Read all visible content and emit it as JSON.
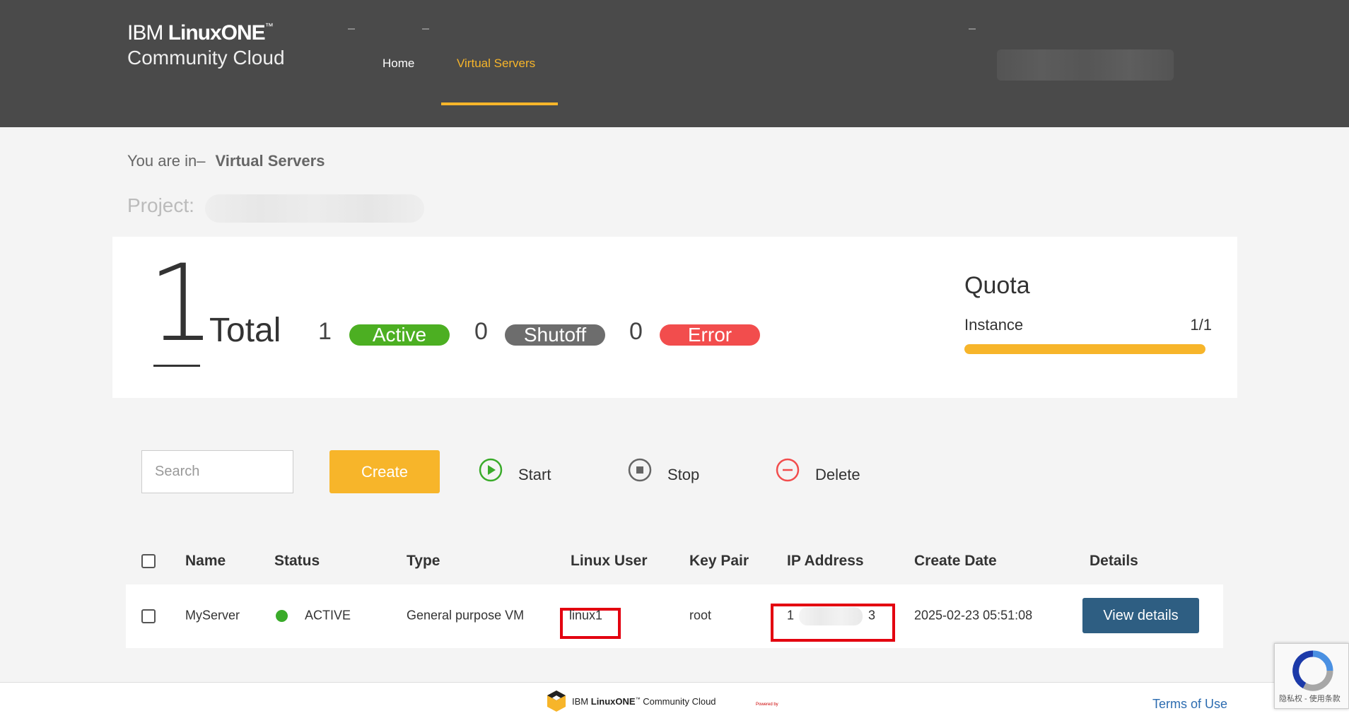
{
  "header": {
    "brand_ibm": "IBM",
    "brand_product": "LinuxONE",
    "brand_tm": "™",
    "brand_line2": "Community Cloud",
    "nav": [
      {
        "label": "Home"
      },
      {
        "label": "Virtual Servers",
        "active": true
      }
    ],
    "accent_color": "#f7b52a"
  },
  "breadcrumb": {
    "prefix": "You are in–",
    "current": "Virtual Servers"
  },
  "project": {
    "label": "Project:"
  },
  "summary": {
    "total_count": "1",
    "total_label": "Total",
    "active_count": "1",
    "active_label": "Active",
    "shutoff_count": "0",
    "shutoff_label": "Shutoff",
    "error_count": "0",
    "error_label": "Error",
    "colors": {
      "active": "#4caf22",
      "shutoff": "#6d6d6d",
      "error": "#f24d4d"
    }
  },
  "quota": {
    "title": "Quota",
    "instance_label": "Instance",
    "instance_value": "1/1",
    "used_fraction": 1.0
  },
  "toolbar": {
    "search_placeholder": "Search",
    "create_label": "Create",
    "start_label": "Start",
    "stop_label": "Stop",
    "delete_label": "Delete",
    "icons": {
      "start": "play-circle-icon",
      "stop": "stop-circle-icon",
      "delete": "minus-circle-icon"
    }
  },
  "table": {
    "columns": [
      "Name",
      "Status",
      "Type",
      "Linux User",
      "Key Pair",
      "IP Address",
      "Create Date",
      "Details"
    ],
    "rows": [
      {
        "name": "MyServer",
        "status": "ACTIVE",
        "type": "General purpose VM",
        "linux_user": "linux1",
        "key_pair": "root",
        "ip_start": "1",
        "ip_end": "3",
        "create_date": "2025-02-23 05:51:08",
        "details_label": "View details"
      }
    ]
  },
  "footer": {
    "logo_ibm": "IBM",
    "logo_product": "LinuxONE",
    "logo_tm": "™",
    "logo_rest": "Community Cloud",
    "powered_by": "Powered by",
    "terms_label": "Terms of Use"
  },
  "recaptcha": {
    "text": "隐私权 - 使用条款"
  }
}
